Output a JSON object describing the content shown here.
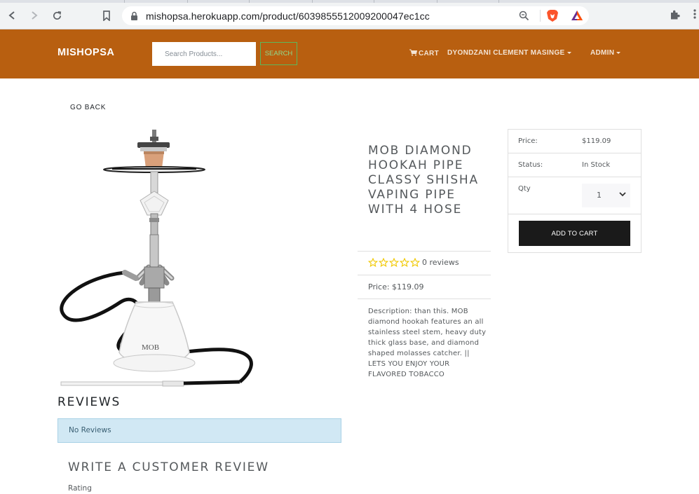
{
  "browser": {
    "url": "mishopsa.herokuapp.com/product/6039855512009200047ec1cc"
  },
  "navbar": {
    "brand": "MISHOPSA",
    "search_placeholder": "Search Products...",
    "search_label": "SEARCH",
    "cart_label": "CART",
    "user_label": "DYONDZANI CLEMENT MASINGE",
    "admin_label": "ADMIN",
    "bg_color": "#b85f10"
  },
  "page": {
    "go_back": "GO BACK"
  },
  "product": {
    "title": "MOB DIAMOND HOOKAH PIPE CLASSY SHISHA VAPING PIPE WITH 4 HOSE",
    "rating": 0,
    "reviews_text": "0 reviews",
    "price_text": "Price: $119.09",
    "description": "Description: than this. MOB diamond hookah features an all stainless steel stem, heavy duty thick glass base, and diamond shaped molasses catcher. || LETS YOU ENJOY YOUR FLAVORED TOBACCO"
  },
  "purchase_card": {
    "price_label": "Price:",
    "price_value": "$119.09",
    "status_label": "Status:",
    "status_value": "In Stock",
    "qty_label": "Qty",
    "qty_value": "1",
    "add_to_cart": "ADD TO CART"
  },
  "reviews": {
    "heading": "REVIEWS",
    "empty_message": "No Reviews",
    "write_heading": "WRITE A CUSTOMER REVIEW",
    "rating_label": "Rating"
  }
}
